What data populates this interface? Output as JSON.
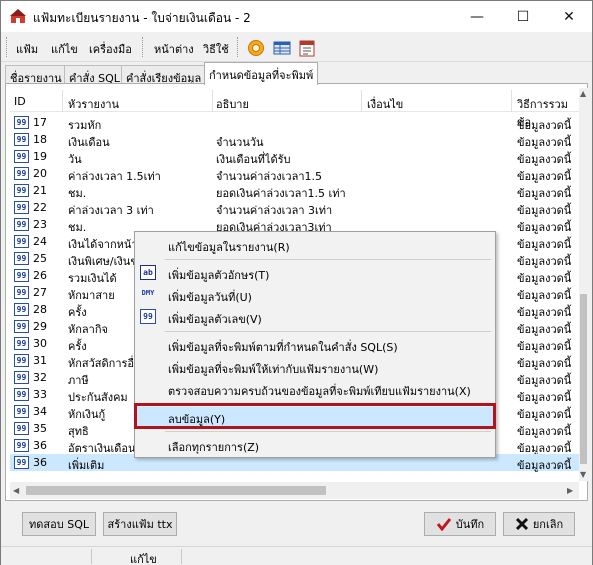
{
  "window": {
    "title": "แฟ้มทะเบียนรายงาน - ใบจ่ายเงินเดือน - 2",
    "controls": {
      "minimize": "—",
      "maximize": "☐",
      "close": "✕"
    }
  },
  "menu": {
    "items": [
      "แฟ้ม",
      "แก้ไข",
      "เครื่องมือ",
      "หน้าต่าง",
      "วิธีใช้"
    ],
    "toolbar_icons": [
      "orange-ball-icon",
      "table-icon",
      "calendar-icon"
    ]
  },
  "tabs": [
    "ชื่อรายงาน",
    "คำสั่ง SQL",
    "คำสั่งเรียงข้อมูล",
    "กำหนดข้อมูลที่จะพิมพ์"
  ],
  "active_tab": 3,
  "columns": [
    "ID",
    "หัวรายงาน",
    "อธิบาย",
    "เงื่อนไข",
    "วิธีการรวมข้อ"
  ],
  "icon_text": "99",
  "rows": [
    {
      "id": "17",
      "header": "รวมหัก",
      "desc": "",
      "cond": "",
      "method": "ข้อมูลงวดนี้"
    },
    {
      "id": "18",
      "header": "เงินเดือน",
      "desc": "จำนวนวัน",
      "cond": "",
      "method": "ข้อมูลงวดนี้"
    },
    {
      "id": "19",
      "header": "วัน",
      "desc": "เงินเดือนที่ได้รับ",
      "cond": "",
      "method": "ข้อมูลงวดนี้"
    },
    {
      "id": "20",
      "header": "ค่าล่วงเวลา 1.5เท่า",
      "desc": "จำนวนค่าล่วงเวลา1.5",
      "cond": "",
      "method": "ข้อมูลงวดนี้"
    },
    {
      "id": "21",
      "header": "ชม.",
      "desc": "ยอดเงินค่าล่วงเวลา1.5 เท่า",
      "cond": "",
      "method": "ข้อมูลงวดนี้"
    },
    {
      "id": "22",
      "header": "ค่าล่วงเวลา 3 เท่า",
      "desc": "จำนวนค่าล่วงเวลา 3เท่า",
      "cond": "",
      "method": "ข้อมูลงวดนี้"
    },
    {
      "id": "23",
      "header": "ชม.",
      "desc": "ยอดเงินค่าล่วงเวลา3เท่า",
      "cond": "",
      "method": "ข้อมูลงวดนี้"
    },
    {
      "id": "24",
      "header": "เงินได้จากหน้า",
      "desc": "",
      "cond": "",
      "method": "ข้อมูลงวดนี้"
    },
    {
      "id": "25",
      "header": "เงินพิเศษ/เงินช",
      "desc": "",
      "cond": "",
      "method": "ข้อมูลงวดนี้"
    },
    {
      "id": "26",
      "header": "รวมเงินได้",
      "desc": "",
      "cond": "",
      "method": "ข้อมูลงวดนี้"
    },
    {
      "id": "27",
      "header": "หักมาสาย",
      "desc": "",
      "cond": "",
      "method": "ข้อมูลงวดนี้"
    },
    {
      "id": "28",
      "header": "ครั้ง",
      "desc": "",
      "cond": "",
      "method": "ข้อมูลงวดนี้"
    },
    {
      "id": "29",
      "header": "หักลากิจ",
      "desc": "",
      "cond": "",
      "method": "ข้อมูลงวดนี้"
    },
    {
      "id": "30",
      "header": "ครั้ง",
      "desc": "",
      "cond": "",
      "method": "ข้อมูลงวดนี้"
    },
    {
      "id": "31",
      "header": "หักสวัสดิการอื่น",
      "desc": "",
      "cond": "",
      "method": "ข้อมูลงวดนี้"
    },
    {
      "id": "32",
      "header": "ภาษี",
      "desc": "",
      "cond": "",
      "method": "ข้อมูลงวดนี้"
    },
    {
      "id": "33",
      "header": "ประกันสังคม",
      "desc": "",
      "cond": "",
      "method": "ข้อมูลงวดนี้"
    },
    {
      "id": "34",
      "header": "หักเงินกู้",
      "desc": "",
      "cond": "",
      "method": "ข้อมูลงวดนี้"
    },
    {
      "id": "35",
      "header": "สุทธิ",
      "desc": "",
      "cond": "",
      "method": "ข้อมูลงวดนี้"
    },
    {
      "id": "36",
      "header": "อัตราเงินเดือน",
      "desc": "",
      "cond": "",
      "method": "ข้อมูลงวดนี้"
    },
    {
      "id": "36",
      "header": "เพิ่มเติม",
      "desc": "",
      "cond": "",
      "method": "ข้อมูลงวดนี้"
    }
  ],
  "context_menu": {
    "edit": "แก้ไขข้อมูลในรายงาน(R)",
    "add_text": "เพิ่มข้อมูลตัวอักษร(T)",
    "add_date": "เพิ่มข้อมูลวันที่(U)",
    "add_number": "เพิ่มข้อมูลตัวเลข(V)",
    "add_sql": "เพิ่มข้อมูลที่จะพิมพ์ตามที่กำหนดในคำสั่ง SQL(S)",
    "add_match": "เพิ่มข้อมูลที่จะพิมพ์ให้เท่ากับแฟ้มรายงาน(W)",
    "verify": "ตรวจสอบความครบถ้วนของข้อมูลที่จะพิมพ์เทียบแฟ้มรายงาน(X)",
    "delete": "ลบข้อมูล(Y)",
    "select_all": "เลือกทุกรายการ(Z)",
    "icon_text_label": "ab",
    "icon_date_label": "DMY",
    "icon_num_label": "99"
  },
  "buttons": {
    "test_sql": "ทดสอบ SQL",
    "create_ttx": "สร้างแฟ้ม ttx",
    "save": "บันทึก",
    "cancel": "ยกเลิก"
  },
  "status": {
    "mode": "แก้ไข"
  },
  "colors": {
    "accent_highlight": "#b1141d",
    "selection": "#cce8ff",
    "save_check": "#c0161c",
    "cancel_x": "#111111"
  }
}
